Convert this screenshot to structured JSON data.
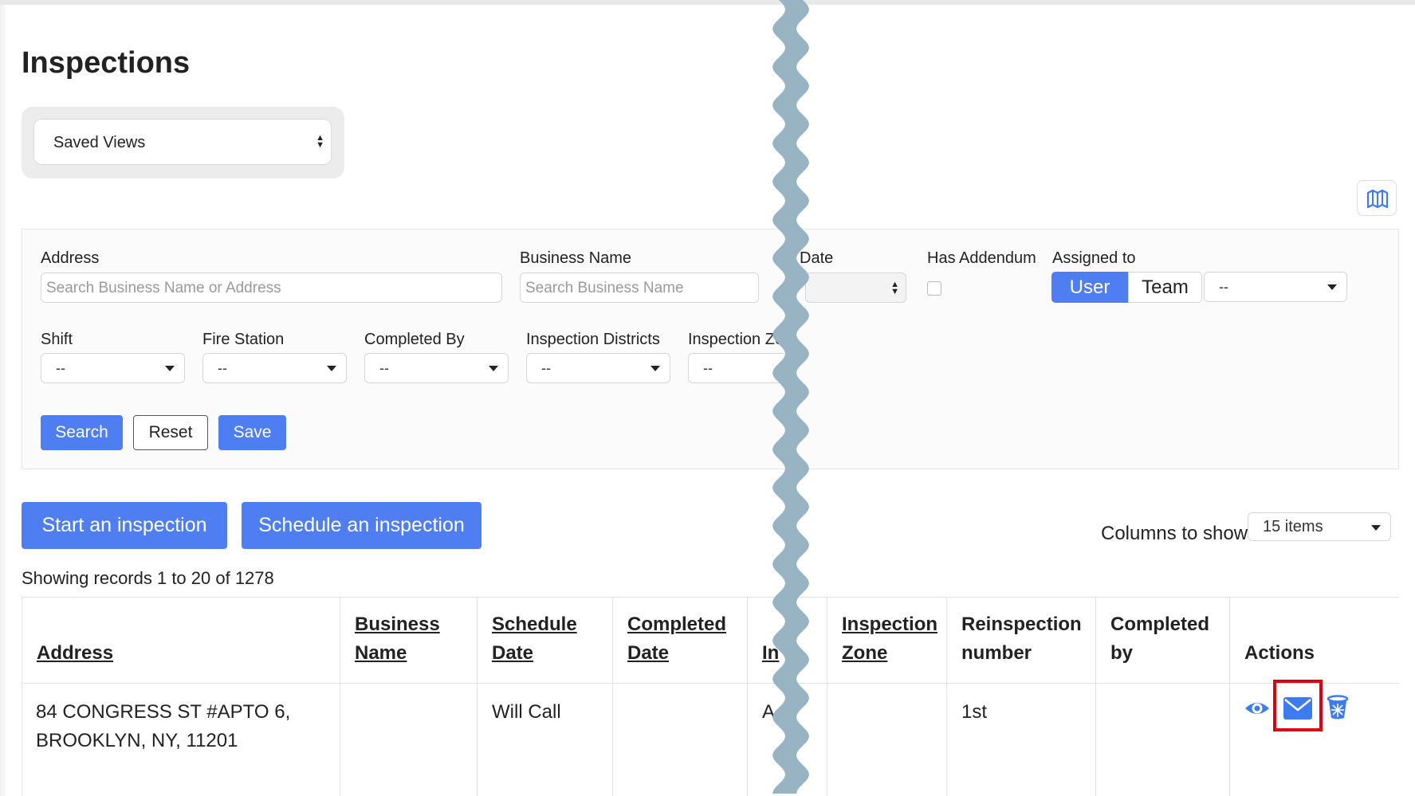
{
  "page": {
    "title": "Inspections"
  },
  "saved_views": {
    "label": "Saved Views"
  },
  "filters": {
    "address": {
      "label": "Address",
      "placeholder": "Search Business Name or Address"
    },
    "business_name": {
      "label": "Business Name",
      "placeholder": "Search Business Name"
    },
    "date": {
      "label": "Date"
    },
    "has_addendum": {
      "label": "Has Addendum"
    },
    "assigned_to": {
      "label": "Assigned to",
      "options": [
        "User",
        "Team"
      ],
      "selected": "User",
      "dropdown_value": "--"
    },
    "shift": {
      "label": "Shift",
      "value": "--"
    },
    "fire_station": {
      "label": "Fire Station",
      "value": "--"
    },
    "completed_by": {
      "label": "Completed By",
      "value": "--"
    },
    "inspection_districts": {
      "label": "Inspection Districts",
      "value": "--"
    },
    "inspection_zone": {
      "label": "Inspection Zo",
      "value": "--"
    },
    "buttons": {
      "search": "Search",
      "reset": "Reset",
      "save": "Save"
    }
  },
  "actions": {
    "start": "Start an inspection",
    "schedule": "Schedule an inspection"
  },
  "columns": {
    "label": "Columns to show",
    "value": "15 items"
  },
  "records": {
    "text": "Showing records 1 to 20 of 1278"
  },
  "table": {
    "headers": {
      "address": [
        "Address"
      ],
      "business_name": [
        "Business",
        "Name"
      ],
      "schedule_date": [
        "Schedule",
        "Date"
      ],
      "completed_date": [
        "Completed",
        "Date"
      ],
      "inspection_type": [
        "In"
      ],
      "inspection_zone": [
        "Inspection",
        "Zone"
      ],
      "reinspection_number": [
        "Reinspection",
        "number"
      ],
      "completed_by": [
        "Completed",
        "by"
      ],
      "actions": [
        "Actions"
      ]
    },
    "rows": [
      {
        "address": [
          "84 CONGRESS ST #APTO 6,",
          "BROOKLYN, NY, 11201"
        ],
        "business_name": "",
        "schedule_date": "Will Call",
        "completed_date": "",
        "inspection_type": "A",
        "inspection_zone": "",
        "reinspection_number": "1st",
        "completed_by": ""
      }
    ]
  },
  "icons": {
    "view": "eye-icon",
    "email": "mail-icon",
    "delete": "trash-icon",
    "map": "map-icon"
  },
  "colors": {
    "primary": "#4f7ef2",
    "icon_blue": "#3d7cf0",
    "highlight": "#e0000f",
    "tear": "#98b4c2"
  }
}
